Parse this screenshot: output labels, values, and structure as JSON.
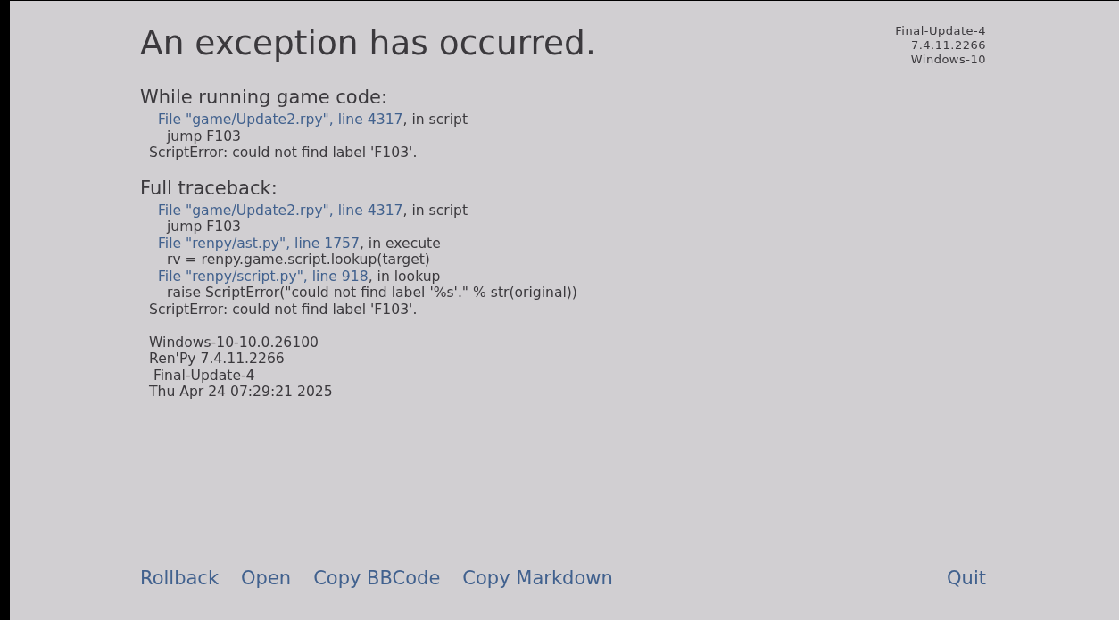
{
  "title": "An exception has occurred.",
  "version_info": [
    "Final-Update-4",
    "7.4.11.2266",
    "Windows-10"
  ],
  "sections": [
    {
      "heading": "While running game code:",
      "lines": [
        {
          "kind": "file",
          "link": "File \"game/Update2.rpy\", line 4317",
          "text": ", in script"
        },
        {
          "kind": "code",
          "text": "jump F103"
        },
        {
          "kind": "error",
          "text": "ScriptError: could not find label 'F103'."
        }
      ]
    },
    {
      "heading": "Full traceback:",
      "lines": [
        {
          "kind": "file",
          "link": "File \"game/Update2.rpy\", line 4317",
          "text": ", in script"
        },
        {
          "kind": "code",
          "text": "jump F103"
        },
        {
          "kind": "file",
          "link": "File \"renpy/ast.py\", line 1757",
          "text": ", in execute"
        },
        {
          "kind": "code",
          "text": "rv = renpy.game.script.lookup(target)"
        },
        {
          "kind": "file",
          "link": "File \"renpy/script.py\", line 918",
          "text": ", in lookup"
        },
        {
          "kind": "code",
          "text": "raise ScriptError(\"could not find label '%s'.\" % str(original))"
        },
        {
          "kind": "error",
          "text": "ScriptError: could not find label 'F103'."
        }
      ]
    }
  ],
  "system_info": [
    "Windows-10-10.0.26100",
    "Ren'Py 7.4.11.2266",
    " Final-Update-4",
    "Thu Apr 24 07:29:21 2025"
  ],
  "buttons": [
    "Rollback",
    "Open",
    "Copy BBCode",
    "Copy Markdown"
  ],
  "quit_button": "Quit"
}
